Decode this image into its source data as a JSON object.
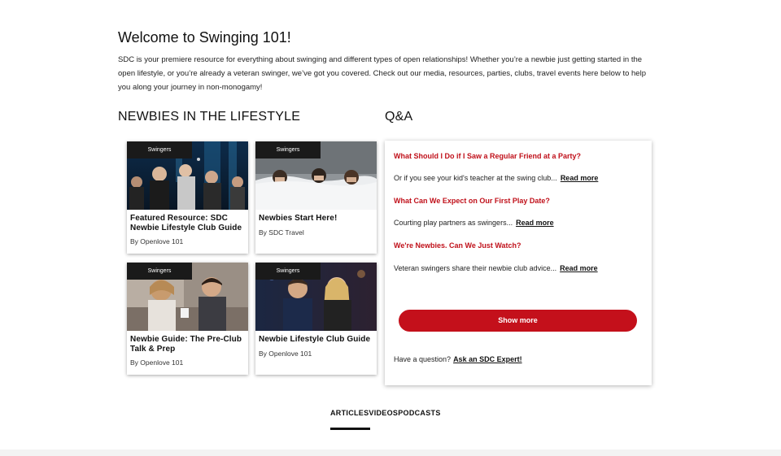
{
  "welcome": {
    "title": "Welcome to Swinging 101!",
    "intro": "SDC is your premiere resource for everything about swinging and different types of open relationships! Whether you’re a newbie just getting started in the open lifestyle, or you’re already a veteran swinger, we’ve got you covered. Check out our media, resources, parties, clubs, travel events here below to help you along your journey in non-monogamy!"
  },
  "newbies": {
    "heading": "NEWBIES IN THE LIFESTYLE",
    "cards": [
      {
        "tag": "Swingers",
        "title": "Featured Resource: SDC Newbie Lifestyle Club Guide",
        "byline": "By Openlove 101",
        "image": "nightclub-crowd-photo"
      },
      {
        "tag": "Swingers",
        "title": "Newbies Start Here!",
        "byline": "By SDC Travel",
        "image": "people-under-blanket-photo"
      },
      {
        "tag": "Swingers",
        "title": "Newbie Guide: The Pre-Club Talk & Prep",
        "byline": "By Openlove 101",
        "image": "couple-talking-photo"
      },
      {
        "tag": "Swingers",
        "title": "Newbie Lifestyle Club Guide",
        "byline": "By Openlove 101",
        "image": "couple-at-bar-photo"
      }
    ]
  },
  "qa": {
    "heading": "Q&A",
    "items": [
      {
        "question": "What Should I Do if I Saw a Regular Friend at a Party?",
        "answer": "Or if you see your kid's teacher at the swing club...",
        "read_more": "Read more"
      },
      {
        "question": "What Can We Expect on Our First Play Date?",
        "answer": "Courting play partners as swingers...",
        "read_more": "Read more"
      },
      {
        "question": "We're Newbies. Can We Just Watch?",
        "answer": "Veteran swingers share their newbie club advice...",
        "read_more": "Read more"
      }
    ],
    "show_more": "Show more",
    "ask_prompt": "Have a question?",
    "ask_link": "Ask an SDC Expert!"
  },
  "media_tabs": {
    "items": [
      "ARTICLES",
      "VIDEOS",
      "PODCASTS"
    ],
    "active": "ARTICLES"
  },
  "colors": {
    "accent": "#c4101b",
    "question_text": "#c0101a",
    "tag_bg": "#1a1a1a"
  }
}
